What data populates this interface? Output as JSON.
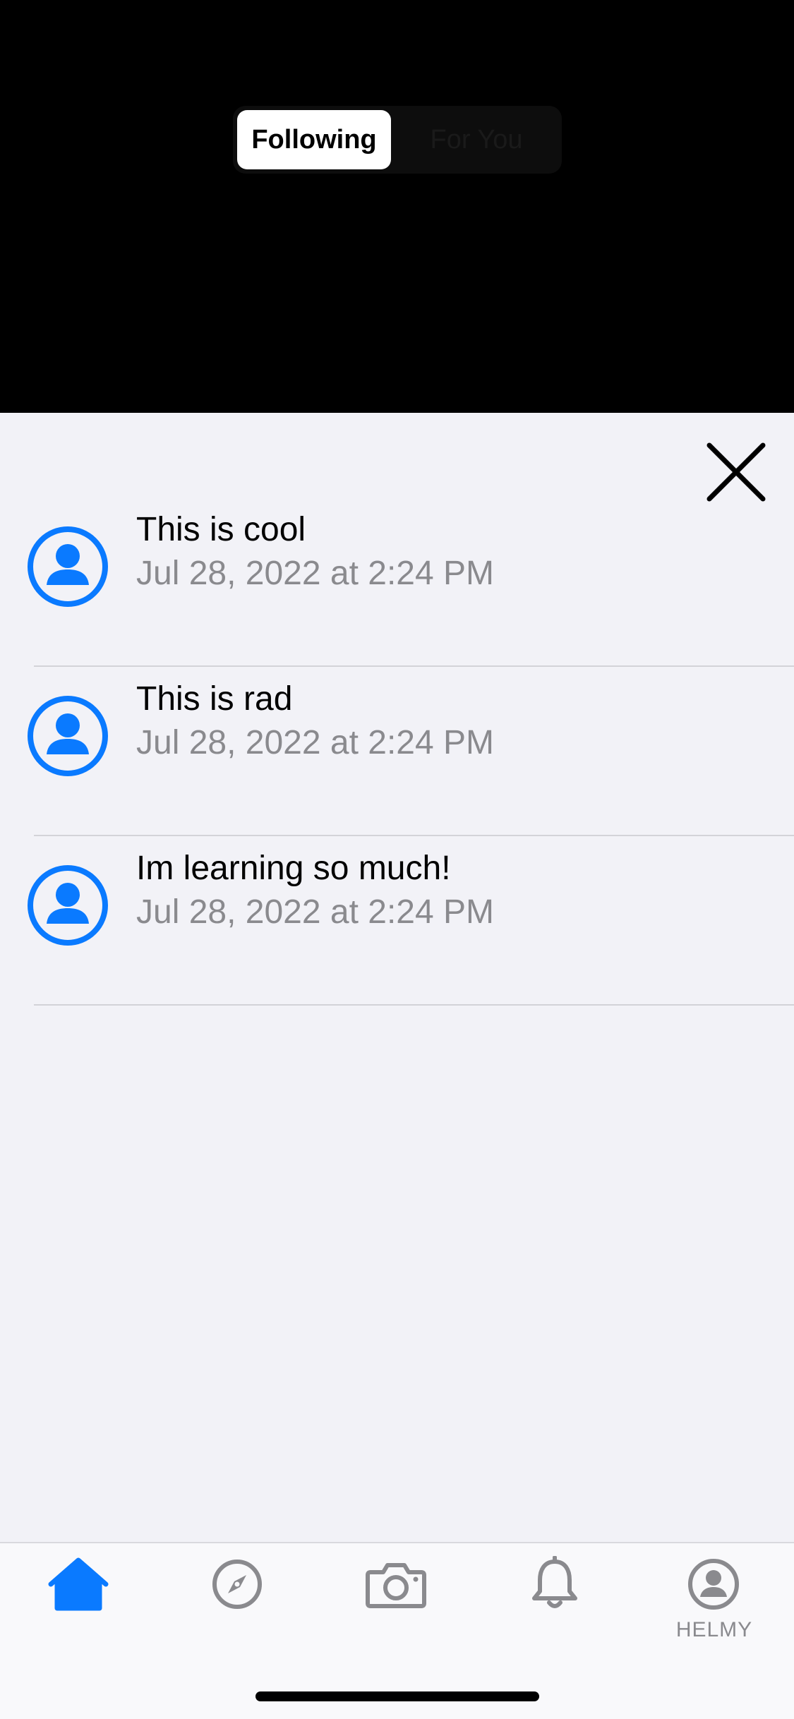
{
  "segmented": {
    "following_label": "Following",
    "for_you_label": "For You",
    "selected": "Following"
  },
  "comments": [
    {
      "text": "This is cool",
      "time": "Jul 28, 2022 at 2:24 PM"
    },
    {
      "text": "This is rad",
      "time": "Jul 28, 2022 at 2:24 PM"
    },
    {
      "text": "Im learning so much!",
      "time": "Jul 28, 2022 at 2:24 PM"
    }
  ],
  "tabbar": {
    "tabs": [
      {
        "icon": "home-icon",
        "active": true
      },
      {
        "icon": "compass-icon",
        "active": false
      },
      {
        "icon": "camera-icon",
        "active": false
      },
      {
        "icon": "bell-icon",
        "active": false
      },
      {
        "icon": "profile-icon",
        "active": false,
        "label": "HELMY"
      }
    ]
  },
  "colors": {
    "accent": "#0a7aff",
    "inactive": "#8a8a8e",
    "sheet_bg": "#f2f2f7",
    "top_bg": "#000000"
  }
}
